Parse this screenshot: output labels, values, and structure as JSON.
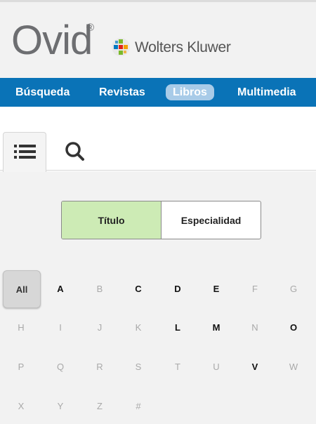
{
  "brand": {
    "product": "Ovid",
    "registered": "®",
    "company": "Wolters Kluwer",
    "logo_colors": [
      "#7ab929",
      "#e2231a",
      "#0079c1",
      "#f29f05"
    ]
  },
  "nav": {
    "items": [
      {
        "label": "Búsqueda",
        "active": false
      },
      {
        "label": "Revistas",
        "active": false
      },
      {
        "label": "Libros",
        "active": true
      },
      {
        "label": "Multimedia",
        "active": false
      }
    ],
    "color": "#0a73b7"
  },
  "tabs": {
    "list_icon": "list-icon",
    "search_icon": "search-icon",
    "active": "list"
  },
  "browse_by": {
    "options": [
      "Título",
      "Especialidad"
    ],
    "selected": "Título",
    "selected_color": "#cdebb5"
  },
  "letters": {
    "items": [
      {
        "label": "All",
        "enabled": true,
        "selected": true
      },
      {
        "label": "A",
        "enabled": true
      },
      {
        "label": "B",
        "enabled": false
      },
      {
        "label": "C",
        "enabled": true
      },
      {
        "label": "D",
        "enabled": true
      },
      {
        "label": "E",
        "enabled": true
      },
      {
        "label": "F",
        "enabled": false
      },
      {
        "label": "G",
        "enabled": false
      },
      {
        "label": "H",
        "enabled": false
      },
      {
        "label": "I",
        "enabled": false
      },
      {
        "label": "J",
        "enabled": false
      },
      {
        "label": "K",
        "enabled": false
      },
      {
        "label": "L",
        "enabled": true
      },
      {
        "label": "M",
        "enabled": true
      },
      {
        "label": "N",
        "enabled": false
      },
      {
        "label": "O",
        "enabled": true
      },
      {
        "label": "P",
        "enabled": false
      },
      {
        "label": "Q",
        "enabled": false
      },
      {
        "label": "R",
        "enabled": false
      },
      {
        "label": "S",
        "enabled": false
      },
      {
        "label": "T",
        "enabled": false
      },
      {
        "label": "U",
        "enabled": false
      },
      {
        "label": "V",
        "enabled": true
      },
      {
        "label": "W",
        "enabled": false
      },
      {
        "label": "X",
        "enabled": false
      },
      {
        "label": "Y",
        "enabled": false
      },
      {
        "label": "Z",
        "enabled": false
      },
      {
        "label": "#",
        "enabled": false
      }
    ]
  }
}
